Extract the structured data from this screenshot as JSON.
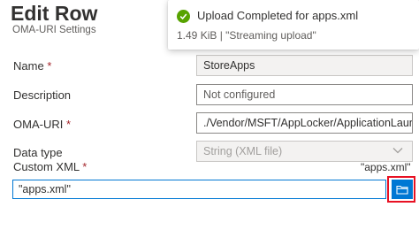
{
  "header": {
    "title": "Edit Row",
    "subtitle": "OMA-URI Settings"
  },
  "form": {
    "name": {
      "label": "Name",
      "required_mark": "*",
      "value": "StoreApps"
    },
    "description": {
      "label": "Description",
      "placeholder": "Not configured"
    },
    "oma_uri": {
      "label": "OMA-URI",
      "required_mark": "*",
      "value": "./Vendor/MSFT/AppLocker/ApplicationLaunch..."
    },
    "data_type": {
      "label": "Data type",
      "value": "String (XML file)"
    },
    "custom_xml": {
      "label": "Custom XML",
      "required_mark": "*",
      "file_name": "\"apps.xml\"",
      "input_value": "\"apps.xml\""
    }
  },
  "toast": {
    "title": "Upload Completed for apps.xml",
    "body": "1.49 KiB | \"Streaming upload\"",
    "status_color": "#57a300"
  },
  "colors": {
    "accent": "#0078d4",
    "highlight": "#e81123",
    "required": "#a4262c"
  },
  "icons": {
    "toast": "check-circle-icon",
    "data_type": "chevron-down-icon",
    "browse": "folder-icon"
  }
}
